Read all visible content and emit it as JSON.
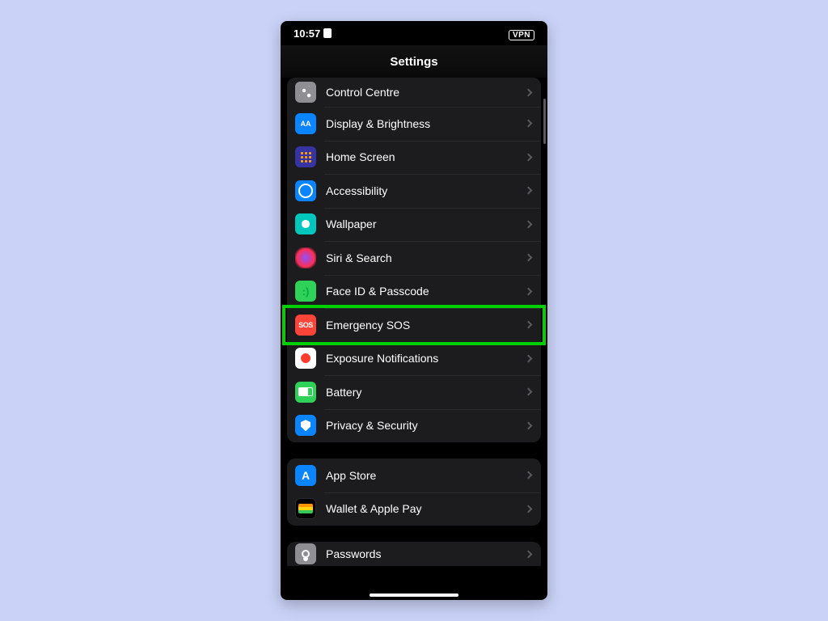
{
  "statusbar": {
    "time": "10:57",
    "vpn": "VPN"
  },
  "nav": {
    "title": "Settings"
  },
  "group1": {
    "items": [
      {
        "label": "Control Centre"
      },
      {
        "label": "Display & Brightness"
      },
      {
        "label": "Home Screen"
      },
      {
        "label": "Accessibility"
      },
      {
        "label": "Wallpaper"
      },
      {
        "label": "Siri & Search"
      },
      {
        "label": "Face ID & Passcode"
      },
      {
        "label": "Emergency SOS"
      },
      {
        "label": "Exposure Notifications"
      },
      {
        "label": "Battery"
      },
      {
        "label": "Privacy & Security"
      }
    ]
  },
  "group2": {
    "items": [
      {
        "label": "App Store"
      },
      {
        "label": "Wallet & Apple Pay"
      }
    ]
  },
  "group3": {
    "items": [
      {
        "label": "Passwords"
      }
    ]
  },
  "iconText": {
    "display": "AA",
    "sos": "SOS"
  },
  "highlighted_row_index": 7
}
